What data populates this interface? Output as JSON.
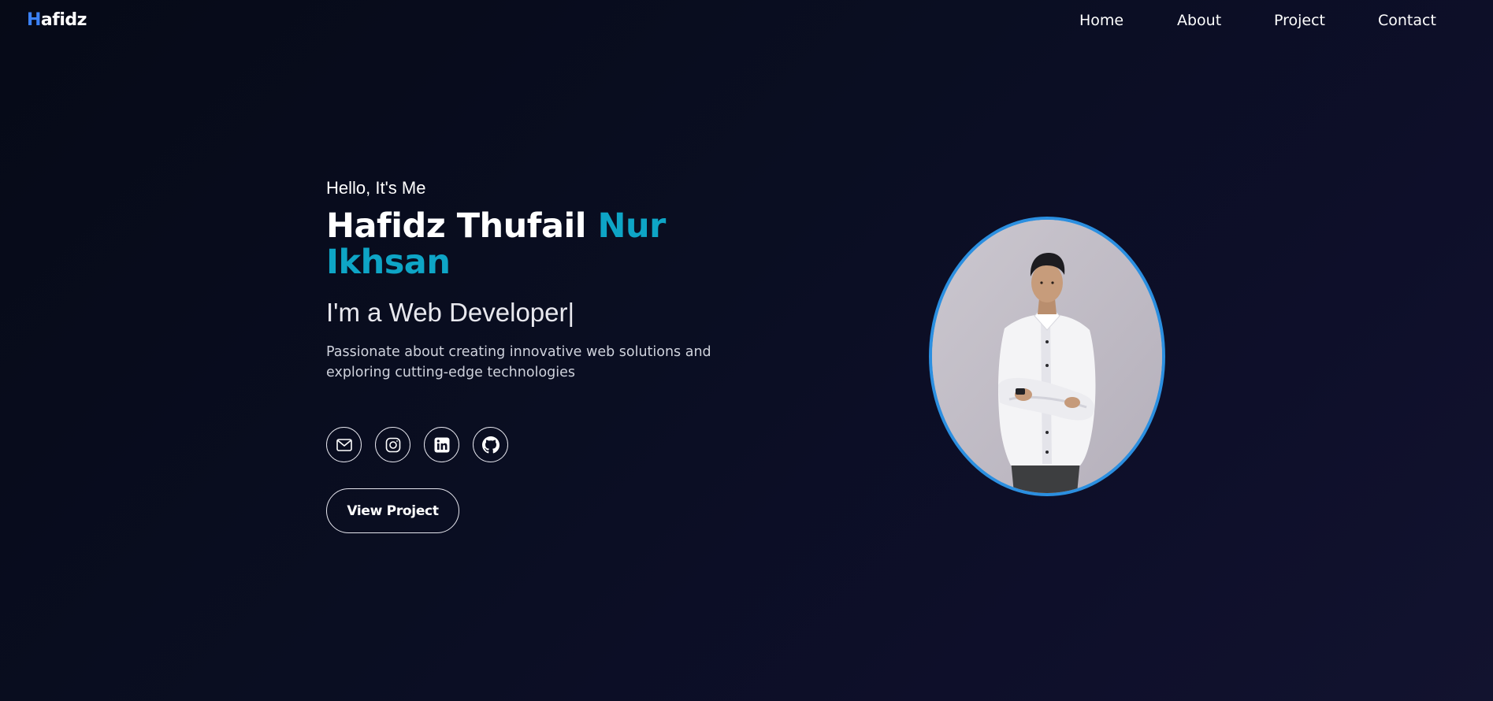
{
  "brand": {
    "first_letter": "H",
    "rest": "afidz",
    "accent_color": "#3b82f6"
  },
  "nav": {
    "items": [
      {
        "label": "Home"
      },
      {
        "label": "About"
      },
      {
        "label": "Project"
      },
      {
        "label": "Contact"
      }
    ]
  },
  "hero": {
    "greeting": "Hello, It's Me",
    "name_part1": "Hafidz Thufail",
    "name_part2": "Nur",
    "name_part3": "Ikhsan",
    "role": "I'm a Web Developer",
    "cursor": "|",
    "tagline": "Passionate about creating innovative web solutions and exploring cutting-edge technologies",
    "accent_color": "#0ea5c6",
    "cta_label": "View Project"
  },
  "socials": [
    {
      "icon": "mail-icon"
    },
    {
      "icon": "instagram-icon"
    },
    {
      "icon": "linkedin-icon"
    },
    {
      "icon": "github-icon"
    }
  ],
  "portrait": {
    "border_color": "#2b8fe0"
  }
}
